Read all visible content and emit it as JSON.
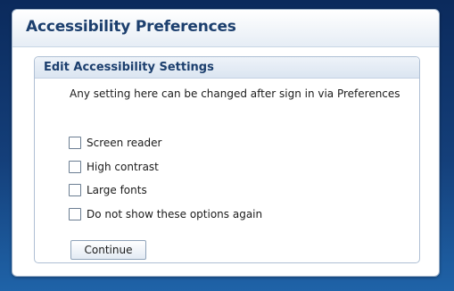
{
  "dialog": {
    "title": "Accessibility Preferences"
  },
  "panel": {
    "title": "Edit Accessibility Settings",
    "description": "Any setting here can be changed after sign in via Preferences",
    "options": [
      {
        "label": "Screen reader",
        "checked": false
      },
      {
        "label": "High contrast",
        "checked": false
      },
      {
        "label": "Large fonts",
        "checked": false
      },
      {
        "label": "Do not show these options again",
        "checked": false
      }
    ],
    "continue_label": "Continue"
  },
  "colors": {
    "background_top": "#0b2a5c",
    "background_bottom": "#1f63a8",
    "title_text": "#1c3f6e"
  }
}
